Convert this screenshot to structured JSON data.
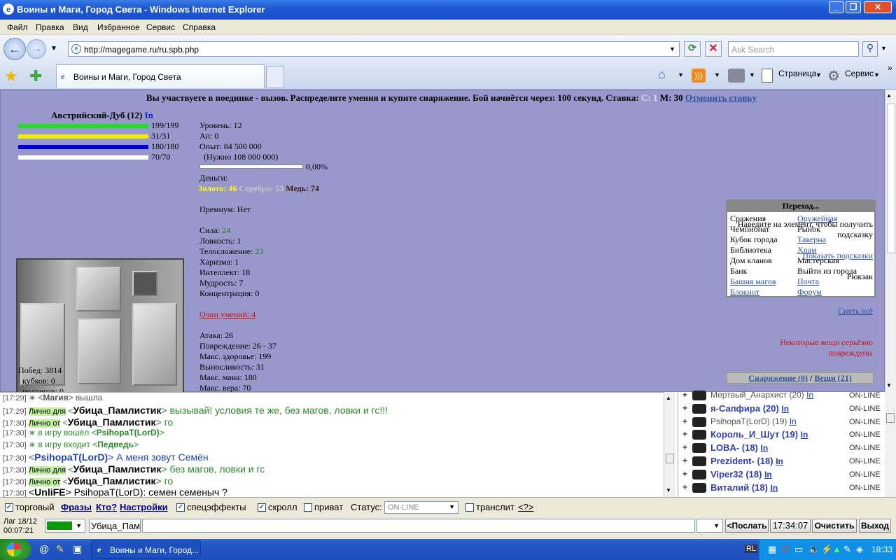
{
  "window": {
    "title": "Воины и Маги, Город Света - Windows Internet Explorer",
    "min": "_",
    "max": "❐",
    "close": "✕"
  },
  "menu": [
    "Файл",
    "Правка",
    "Вид",
    "Избранное",
    "Сервис",
    "Справка"
  ],
  "address": {
    "url": "http://magegame.ru/ru.spb.php",
    "search_placeholder": "Ask Search"
  },
  "tab": {
    "label": "Воины и Маги, Город Света"
  },
  "toolbar": {
    "page": "Страница",
    "service": "Сервис"
  },
  "game": {
    "status": "Вы участвуете в поединке - вызов. Распределите умения и купите снаряжение. Бой начнётся через: 100 секунд. Ставка:",
    "stake_s": "С: 1",
    "stake_m": "М: 30",
    "cancel": "Отменить ставку",
    "char_name": "Австрийский-Дуб (12)",
    "char_in": "In",
    "bars": [
      {
        "val": "199/199",
        "color": "#22dd22",
        "fill": 1
      },
      {
        "val": "31/31",
        "color": "#eeee00",
        "fill": 1
      },
      {
        "val": "180/180",
        "color": "#0000dd",
        "fill": 1
      },
      {
        "val": "70/70",
        "color": "#ffffff",
        "fill": 1
      }
    ],
    "stats_top": [
      "Уровень: 12",
      "Ап: 0",
      "Опыт: 84 500 000",
      "(Нужно 108 000 000)"
    ],
    "exp_pct": "0,00%",
    "money_label": "Деньги:",
    "gold": "Золото: 46",
    "silver": "Серебро: 53",
    "copper": "Медь: 74",
    "premium": "Премиум: Нет",
    "attrs": [
      {
        "k": "Сила: ",
        "v": "24"
      },
      {
        "k": "Ловкость: 1",
        "v": ""
      },
      {
        "k": "Телосложение: ",
        "v": "23"
      },
      {
        "k": "Харизма: 1",
        "v": ""
      },
      {
        "k": "Интеллект: 18",
        "v": ""
      },
      {
        "k": "Мудрость: 7",
        "v": ""
      },
      {
        "k": "Концентрация: 0",
        "v": ""
      }
    ],
    "skill_points": "Очки умений: 4",
    "combat": [
      "Атака: 26",
      "Повреждение: 26 - 37",
      "Макс. здоровье: 199",
      "Выносливость: 31",
      "Макс. мана: 180",
      "Макс. вера: 70"
    ],
    "wins": [
      "Побед: 3814",
      "кубков: 0",
      "подвигов: 0"
    ],
    "nav_title": "Переход...",
    "nav": [
      [
        "Сражения",
        "Оружейная"
      ],
      [
        "Чемпионат",
        "Рынок"
      ],
      [
        "Кубок города",
        "Таверна"
      ],
      [
        "Библиотека",
        "Храм"
      ],
      [
        "Дом кланов",
        "Мастерская"
      ],
      [
        "Банк",
        "Выйти из города"
      ],
      [
        "Башня магов",
        "Почта"
      ],
      [
        "Блокнот",
        "Форум"
      ]
    ],
    "nav_links": [
      [
        false,
        true
      ],
      [
        false,
        false
      ],
      [
        false,
        true
      ],
      [
        false,
        true
      ],
      [
        false,
        false
      ],
      [
        false,
        false
      ],
      [
        true,
        true
      ],
      [
        true,
        true
      ]
    ],
    "hint": "Наведите на элемент, чтобы получить подсказку",
    "show_hints": "Показать подсказки",
    "backpack": "Рюкзак",
    "gear": "Снаряжение (0)",
    "sep": "/",
    "things": "Вещи (21)",
    "remove_all": "Снять всё",
    "damaged": "Некоторые вещи серьёзно повреждены"
  },
  "chat": [
    {
      "ts": "[17:29]",
      "parts": [
        {
          "t": "∗ <",
          "c": "#555"
        },
        {
          "t": "Магия",
          "c": "#555",
          "b": true
        },
        {
          "t": "> вышла",
          "c": "#555"
        }
      ]
    },
    {
      "ts": "[17:29]",
      "label": "Лично для",
      "parts": [
        {
          "t": " <",
          "c": "#2a8a2a"
        },
        {
          "t": "Убица_Памлистик",
          "c": "#000",
          "b": true,
          "big": true
        },
        {
          "t": "> вызывай! условия те же, без магов, ловки и гс!!!",
          "c": "#2a8a2a",
          "big": true
        }
      ]
    },
    {
      "ts": "[17:30]",
      "label": "Лично от",
      "parts": [
        {
          "t": " <",
          "c": "#2a8a2a"
        },
        {
          "t": "Убица_Памлистик",
          "c": "#000",
          "b": true,
          "big": true
        },
        {
          "t": "> го",
          "c": "#2a8a2a",
          "big": true
        }
      ]
    },
    {
      "ts": "[17:30]",
      "parts": [
        {
          "t": "∗ в игру вошёл <",
          "c": "#2a8a2a"
        },
        {
          "t": "PsihopaT(LorD)",
          "c": "#2a8a2a",
          "b": true
        },
        {
          "t": ">",
          "c": "#2a8a2a"
        }
      ]
    },
    {
      "ts": "[17:30]",
      "parts": [
        {
          "t": "∗ в игру входит <",
          "c": "#2a8a2a"
        },
        {
          "t": "Педведь",
          "c": "#2a8a2a",
          "b": true
        },
        {
          "t": ">",
          "c": "#2a8a2a"
        }
      ]
    },
    {
      "ts": "[17:30]",
      "parts": [
        {
          "t": "<",
          "c": "#2244bb",
          "big": true
        },
        {
          "t": "PsihopaT(LorD)",
          "c": "#2244bb",
          "b": true,
          "big": true
        },
        {
          "t": "> А меня зовут Семён",
          "c": "#2244bb",
          "big": true
        }
      ]
    },
    {
      "ts": "[17:30]",
      "label": "Лично для",
      "parts": [
        {
          "t": " <",
          "c": "#2a8a2a"
        },
        {
          "t": "Убица_Памлистик",
          "c": "#000",
          "b": true,
          "big": true
        },
        {
          "t": "> без магов, ловки и гс",
          "c": "#2a8a2a",
          "big": true
        }
      ]
    },
    {
      "ts": "[17:30]",
      "label": "Лично от",
      "parts": [
        {
          "t": " <",
          "c": "#2a8a2a"
        },
        {
          "t": "Убица_Памлистик",
          "c": "#000",
          "b": true,
          "big": true
        },
        {
          "t": "> го",
          "c": "#2a8a2a",
          "big": true
        }
      ]
    },
    {
      "ts": "[17:30]",
      "parts": [
        {
          "t": "<",
          "c": "#000",
          "big": true
        },
        {
          "t": "UnliFE",
          "c": "#000",
          "b": true,
          "big": true
        },
        {
          "t": "> PsihopaT(LorD): семен семеныч ?",
          "c": "#000",
          "big": true
        }
      ]
    }
  ],
  "users": [
    {
      "name": "Мертвый_Анархист (20)",
      "status": "ON-LINE",
      "in": "In",
      "dim": true
    },
    {
      "name": "я-Сапфира (20)",
      "status": "ON-LINE",
      "in": "In"
    },
    {
      "name": "PsihopaT(LorD) (19)",
      "status": "ON-LINE",
      "in": "In",
      "dim": true
    },
    {
      "name": "Король_И_Шут (19)",
      "status": "ON-LINE",
      "in": "In"
    },
    {
      "name": "LOBA- (18)",
      "status": "ON-LINE",
      "in": "In"
    },
    {
      "name": "Prezident- (18)",
      "status": "ON-LINE",
      "in": "In"
    },
    {
      "name": "Viper32 (18)",
      "status": "ON-LINE",
      "in": "In"
    },
    {
      "name": "Виталий (18)",
      "status": "ON-LINE",
      "in": "In"
    }
  ],
  "controls": {
    "trade": "торговый",
    "phrases": "Фразы",
    "who": "Кто?",
    "settings": "Настройки",
    "effects": "спецэффекты",
    "scroll": "скролл",
    "private": "приват",
    "status_label": "Статус:",
    "status_val": "ON-LINE",
    "translit": "транслит",
    "translit_q": "<?>",
    "lag": "Лаг 18/12",
    "uptime": "00:07:21",
    "nick": "Убица_Пам",
    "send": "<Послать",
    "time": "17:34:07",
    "clear": "Очистить",
    "exit": "Выход"
  },
  "taskbar": {
    "task": "Воины и Маги, Город...",
    "clock": "18:33",
    "lang": "RL"
  }
}
